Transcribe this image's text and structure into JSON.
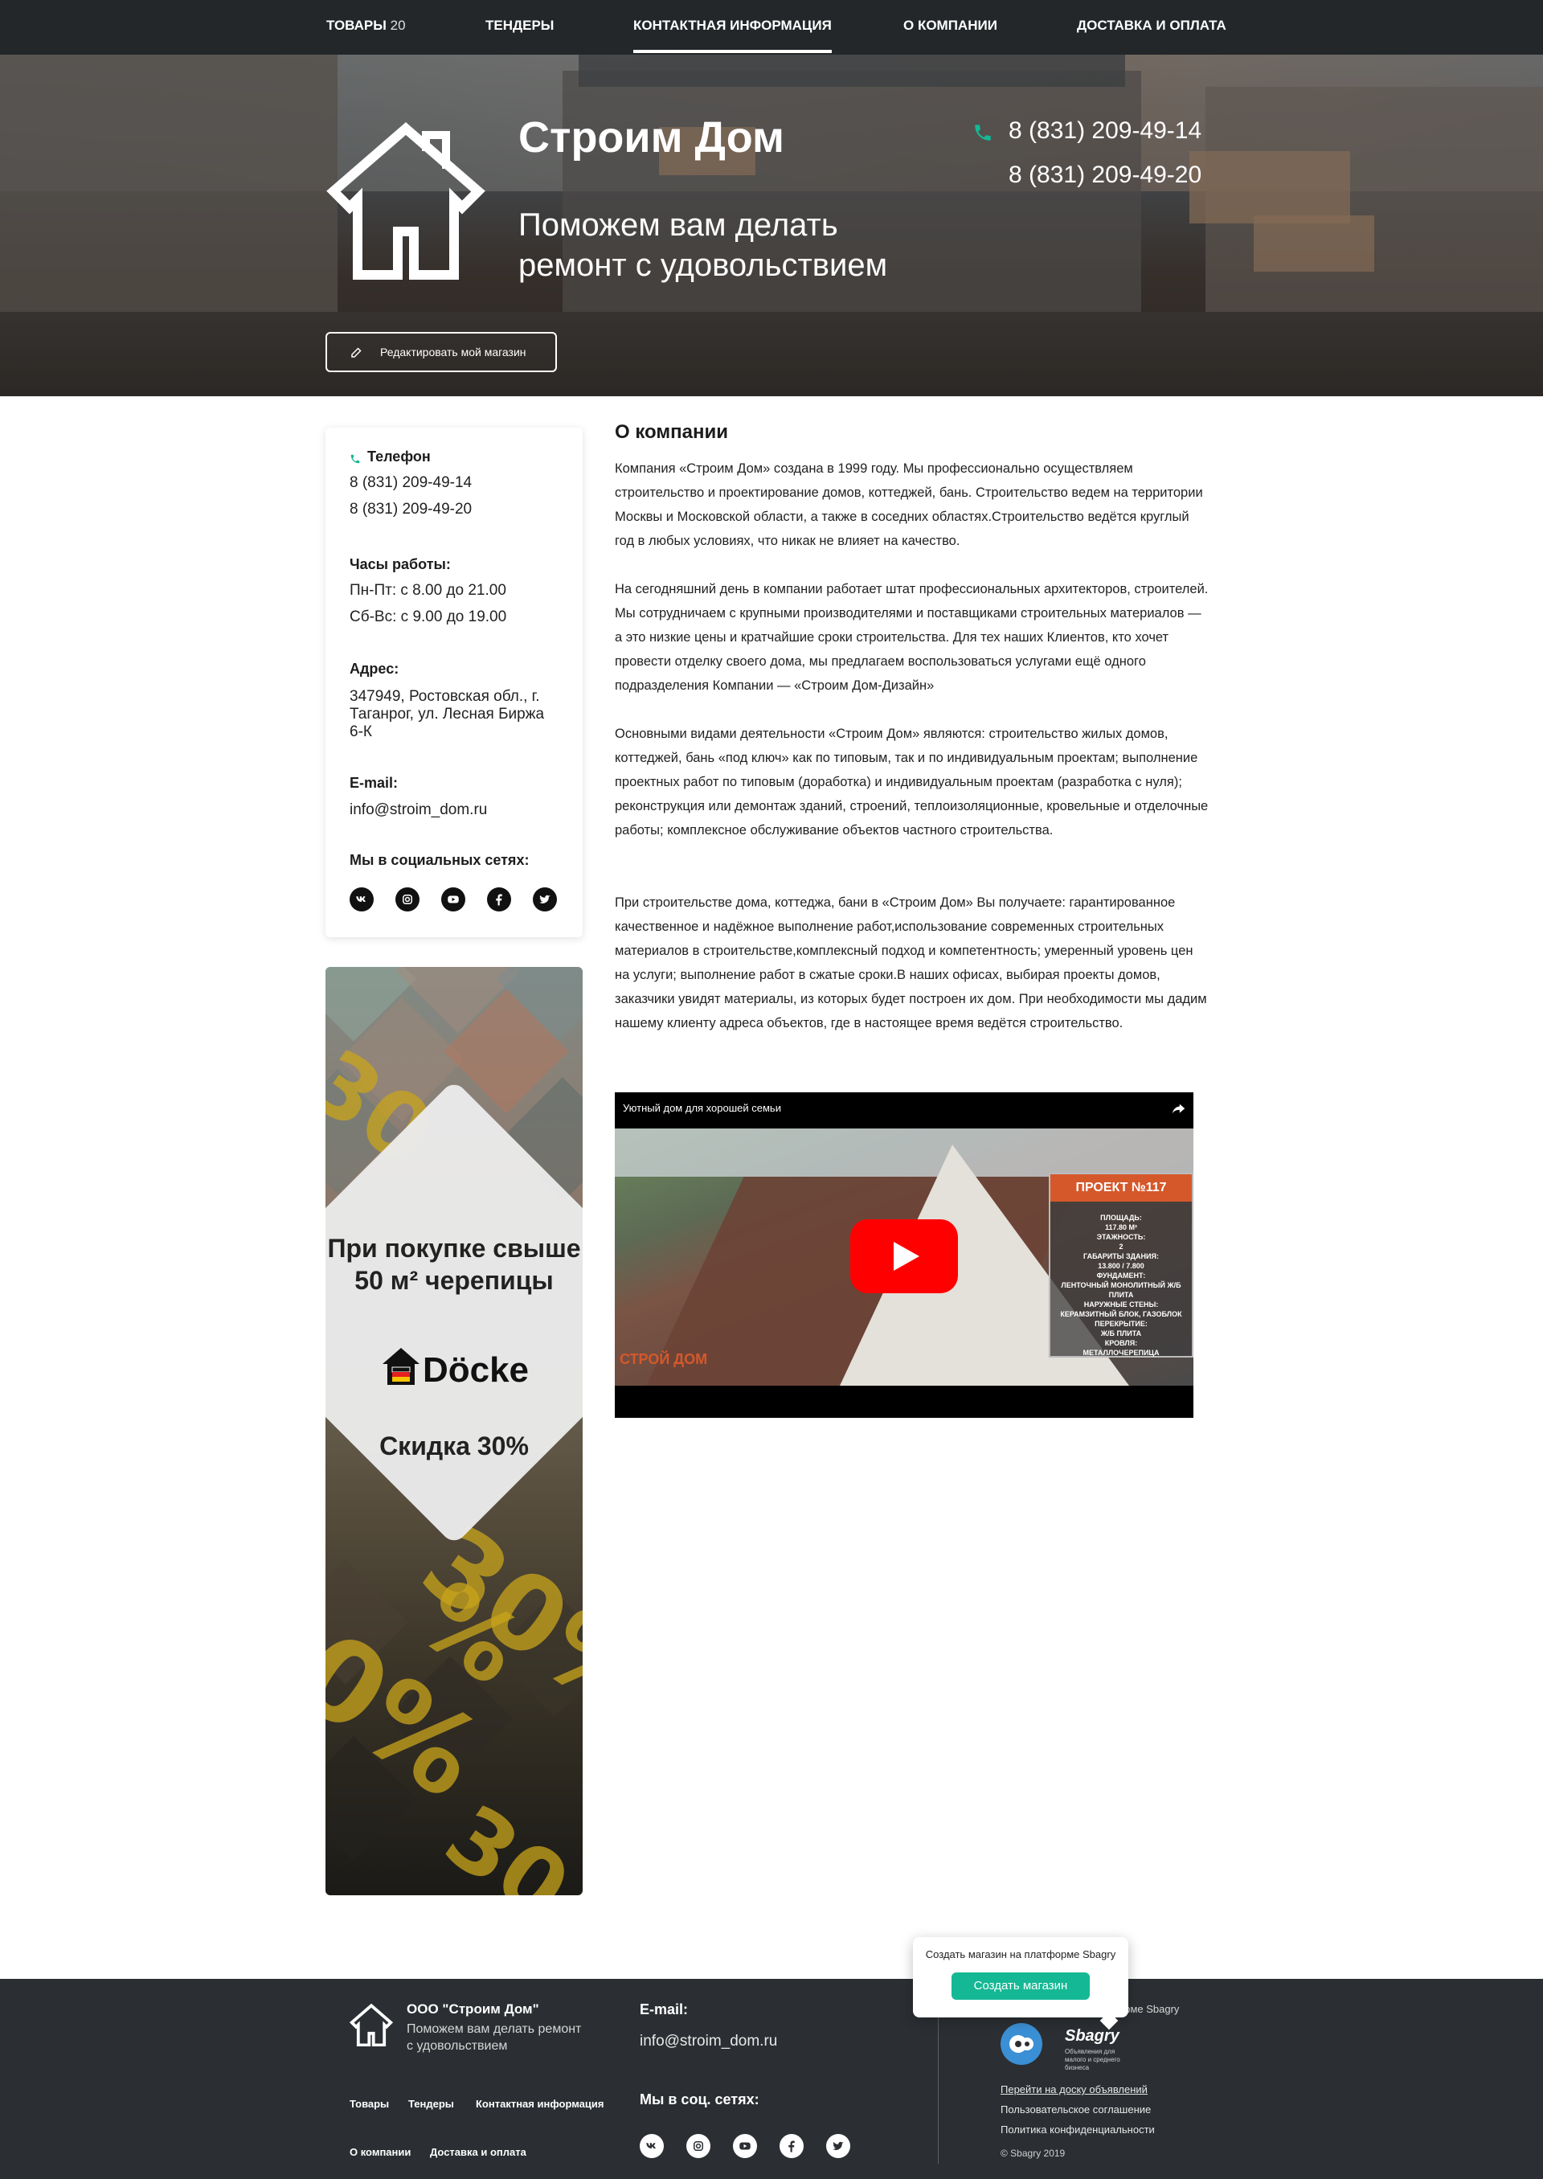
{
  "nav": {
    "items": [
      {
        "label": "ТОВАРЫ",
        "count": "20"
      },
      {
        "label": "ТЕНДЕРЫ"
      },
      {
        "label": "КОНТАКТНАЯ ИНФОРМАЦИЯ",
        "active": true
      },
      {
        "label": "О КОМПАНИИ"
      },
      {
        "label": "ДОСТАВКА И ОПЛАТА"
      }
    ]
  },
  "hero": {
    "title": "Строим Дом",
    "subtitle": "Поможем вам делать ремонт с удовольствием",
    "phones": [
      "8 (831) 209-49-14",
      "8 (831) 209-49-20"
    ],
    "edit_button": "Редактировать мой магазин"
  },
  "contacts": {
    "phone_label": "Телефон",
    "phones": [
      "8 (831) 209-49-14",
      "8 (831) 209-49-20"
    ],
    "hours_label": "Часы работы:",
    "hours": [
      "Пн-Пт: с 8.00 до 21.00",
      "Сб-Вс: с 9.00 до 19.00"
    ],
    "address_label": "Адрес:",
    "address": "347949, Ростовская обл., г. Таганрог, ул. Лесная Биржа 6-К",
    "email_label": "E-mail:",
    "email": "info@stroim_dom.ru",
    "social_label": "Мы в социальных сетях:",
    "social_icons": [
      "vk-icon",
      "instagram-icon",
      "youtube-icon",
      "facebook-icon",
      "twitter-icon"
    ]
  },
  "promo": {
    "text_top": "При покупке свыше 50 м² черепицы",
    "brand": "Döcke",
    "text_bottom": "Скидка 30%",
    "accent_color": "#c9a51b"
  },
  "about": {
    "title": "О компании",
    "paragraphs": [
      "Компания «Строим Дом» создана в 1999 году. Мы профессионально осуществляем строительство и проектирование домов, коттеджей, бань. Строительство ведем на территории Москвы и Московской области, а также в соседних областях.Строительство ведётся круглый год в любых условиях, что никак не влияет на качество.",
      "На сегодняшний день в компании работает штат профессиональных архитекторов, строителей. Мы сотрудничаем с крупными производителями и поставщиками строительных материалов — а это низкие цены и кратчайшие сроки строительства. Для тех наших Клиентов, кто хочет провести отделку своего дома, мы предлагаем воспользоваться услугами ещё одного подразделения Компании — «Строим Дом-Дизайн»",
      "Основными видами деятельности «Строим Дом» являются: строительство жилых домов, коттеджей, бань «под ключ» как по типовым, так и по индивидуальным проектам; выполнение проектных работ по типовым (доработка) и индивидуальным проектам (разработка с нуля); реконструкция или демонтаж зданий, строений, теплоизоляционные, кровельные и отделочные работы; комплексное обслуживание объектов частного строительства.",
      "При строительстве дома, коттеджа, бани в «Строим Дом» Вы получаете: гарантированное качественное и надёжное выполнение работ,использование современных строительных материалов в строительстве,комплексный подход и компетентность; умеренный уровень цен на услуги; выполнение работ в сжатые сроки.В наших офисах, выбирая проекты домов, заказчики увидят материалы, из которых будет построен их дом. При необходимости мы дадим нашему клиенту адреса объектов, где в настоящее время ведётся строительство."
    ]
  },
  "video": {
    "title": "Уютный дом для хорошей семьи",
    "project_heading": "ПРОЕКТ №117",
    "project_specs": [
      "ПЛОЩАДЬ:",
      "117.80 М²",
      "ЭТАЖНОСТЬ:",
      "2",
      "ГАБАРИТЫ ЗДАНИЯ:",
      "13.800 / 7.800",
      "ФУНДАМЕНТ:",
      "ЛЕНТОЧНЫЙ МОНОЛИТНЫЙ Ж/Б ПЛИТА",
      "НАРУЖНЫЕ СТЕНЫ:",
      "КЕРАМЗИТНЫЙ БЛОК, ГАЗОБЛОК",
      "ПЕРЕКРЫТИЕ:",
      "Ж/Б ПЛИТА",
      "КРОВЛЯ:",
      "МЕТАЛЛОЧЕРЕПИЦА"
    ],
    "watermark": "СТРОЙ ДОМ"
  },
  "footer": {
    "company": "ООО \"Строим Дом\"",
    "tagline": "Поможем вам делать ремонт с удовольствием",
    "links_row1": [
      "Товары",
      "Тендеры",
      "Контактная информация"
    ],
    "links_row2": [
      "О компании",
      "Доставка и оплата"
    ],
    "email_label": "E-mail:",
    "email": "info@stroim_dom.ru",
    "social_label": "Мы в соц. сетях:",
    "platform_text": "орме Sbagry",
    "sbagry_name": "Sbagry",
    "sbagry_tagline": "Объявления для малого и среднего бизнеса",
    "service_links": [
      "Перейти на доску объявлений",
      "Пользовательское соглашение",
      "Политика конфиденциальности"
    ],
    "copyright": "© Sbagry 2019"
  },
  "popup": {
    "text": "Создать магазин на платформе Sbagry",
    "button": "Создать магазин",
    "button_color": "#15b894"
  }
}
